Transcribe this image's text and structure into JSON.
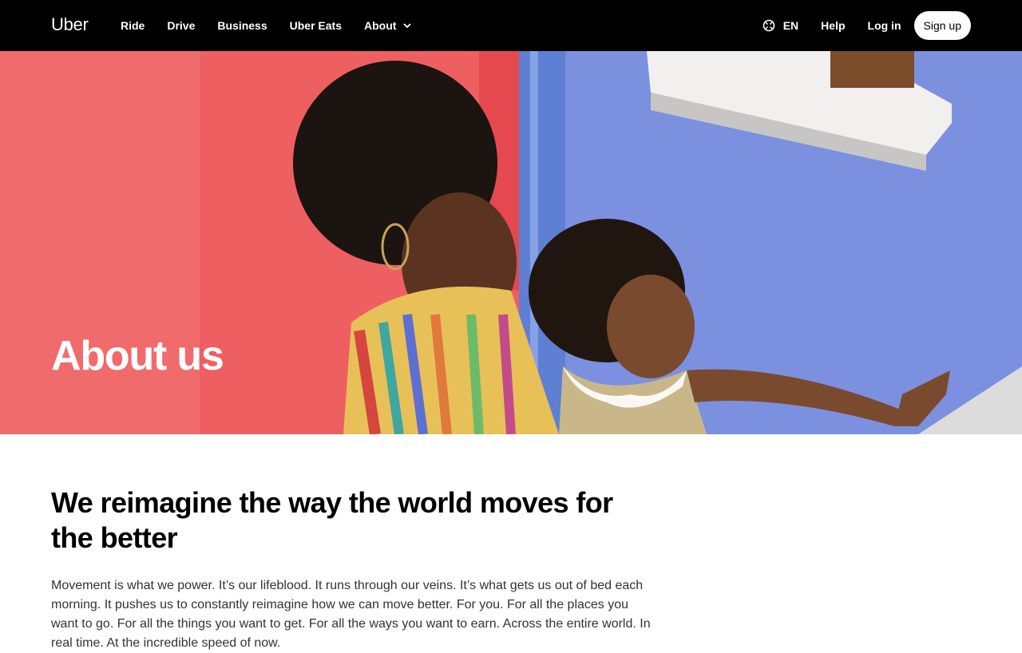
{
  "nav": {
    "logo": "Uber",
    "links": [
      "Ride",
      "Drive",
      "Business",
      "Uber Eats",
      "About"
    ],
    "language": "EN",
    "help": "Help",
    "login": "Log in",
    "signup": "Sign up"
  },
  "hero": {
    "title": "About us",
    "image_alt": "Woman holding a young girl in front of red and blue painted walls"
  },
  "main": {
    "headline": "We reimagine the way the world moves for the better",
    "body": "Movement is what we power. It’s our lifeblood. It runs through our veins. It’s what gets us out of bed each morning. It pushes us to constantly reimagine how we can move better. For you. For all the places you want to go. For all the things you want to get. For all the ways you want to earn. Across the entire world. In real time. At the incredible speed of now."
  },
  "colors": {
    "nav_bg": "#000000",
    "wall_red": "#EE5F62",
    "wall_blue": "#7C90E0"
  }
}
